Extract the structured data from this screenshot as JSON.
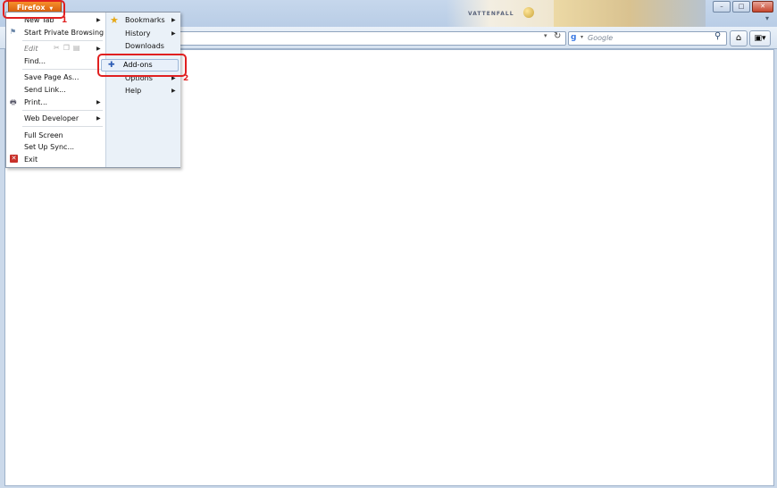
{
  "window": {
    "brand_text": "VATTENFALL",
    "controls": {
      "minimize": "–",
      "maximize": "□",
      "close": "✕"
    },
    "tabs_dropdown": "▾"
  },
  "firefox_button": {
    "label": "Firefox",
    "chevron": "▼"
  },
  "navbar": {
    "search_placeholder": "Google",
    "search_engine_icon": "g-icon"
  },
  "menu": {
    "left": [
      {
        "label": "New Tab",
        "submenu": true
      },
      {
        "label": "Start Private Browsing",
        "submenu": false
      },
      {
        "label": "Edit",
        "submenu": true,
        "disabled": true
      },
      {
        "label": "Find...",
        "submenu": false
      },
      {
        "label": "Save Page As...",
        "submenu": false
      },
      {
        "label": "Send Link...",
        "submenu": false
      },
      {
        "label": "Print...",
        "submenu": true
      },
      {
        "label": "Web Developer",
        "submenu": true
      },
      {
        "label": "Full Screen",
        "submenu": false
      },
      {
        "label": "Set Up Sync...",
        "submenu": false
      },
      {
        "label": "Exit",
        "submenu": false
      }
    ],
    "right": [
      {
        "label": "Bookmarks",
        "submenu": true
      },
      {
        "label": "History",
        "submenu": true
      },
      {
        "label": "Downloads",
        "submenu": false
      },
      {
        "label": "Add-ons",
        "submenu": false,
        "highlighted": true
      },
      {
        "label": "Options",
        "submenu": true
      },
      {
        "label": "Help",
        "submenu": true
      }
    ]
  },
  "annotations": {
    "step1": "1",
    "step2": "2",
    "color": "#e02020"
  }
}
